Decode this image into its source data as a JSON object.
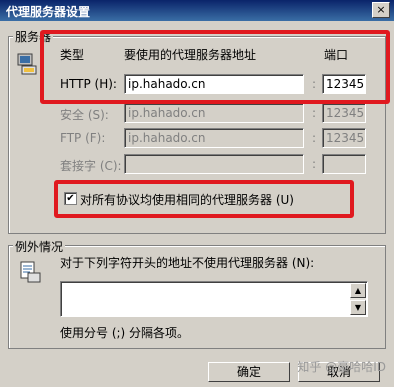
{
  "window": {
    "title": "代理服务器设置",
    "close_glyph": "×"
  },
  "servers": {
    "legend": "服务器",
    "headers": {
      "type": "类型",
      "address": "要使用的代理服务器地址",
      "port": "端口"
    },
    "rows": [
      {
        "label": "HTTP (H):",
        "address": "ip.hahado.cn",
        "port": "12345",
        "enabled": true
      },
      {
        "label": "安全 (S):",
        "address": "ip.hahado.cn",
        "port": "12345",
        "enabled": false
      },
      {
        "label": "FTP (F):",
        "address": "ip.hahado.cn",
        "port": "12345",
        "enabled": false
      },
      {
        "label": "套接字 (C):",
        "address": "",
        "port": "",
        "enabled": false
      }
    ],
    "colon": ":",
    "same_proxy": {
      "label": "对所有协议均使用相同的代理服务器 (U)",
      "checked": true,
      "check_glyph": "✔"
    }
  },
  "exceptions": {
    "legend": "例外情况",
    "description": "对于下列字符开头的地址不使用代理服务器 (N):",
    "value": "",
    "hint": "使用分号 (;) 分隔各项。",
    "scroll_up": "▲",
    "scroll_down": "▼"
  },
  "buttons": {
    "ok": "确定",
    "cancel": "取消"
  },
  "watermark": "知乎 @豪哈哈ID",
  "colors": {
    "highlight": "#e0191f",
    "titlebar": "#0a246a"
  }
}
